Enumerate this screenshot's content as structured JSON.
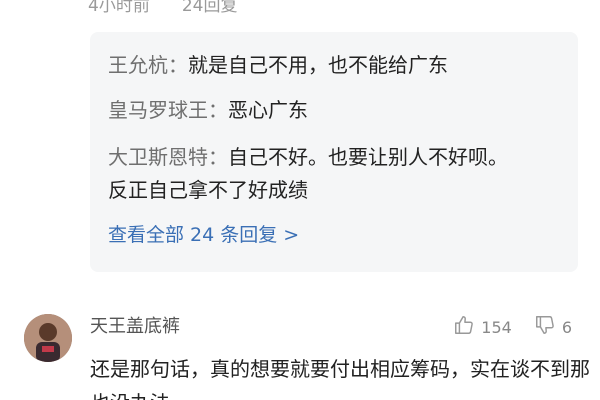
{
  "top_meta": {
    "time": "4小时前",
    "reply_count": "24回复"
  },
  "replies": [
    {
      "name": "王允杭：",
      "text": "就是自己不用，也不能给广东"
    },
    {
      "name": "皇马罗球王：",
      "text": "恶心广东"
    },
    {
      "name": "大卫斯恩特：",
      "text": "自己不好。也要让别人不好呗。",
      "text_cont": "反正自己拿不了好成绩"
    }
  ],
  "view_all": "查看全部 24 条回复 >",
  "comment": {
    "username": "天王盖底裤",
    "likes": "154",
    "dislikes": "6",
    "text": "还是那句话，真的想要就要付出相应筹码，实在谈不到那也没办法"
  },
  "icons": {
    "like": "thumbs-up-icon",
    "dislike": "thumbs-down-icon",
    "more": "more-icon"
  },
  "colors": {
    "link": "#3a6fb5",
    "reply_bg": "#f5f6f7",
    "meta": "#9a9a9a"
  }
}
